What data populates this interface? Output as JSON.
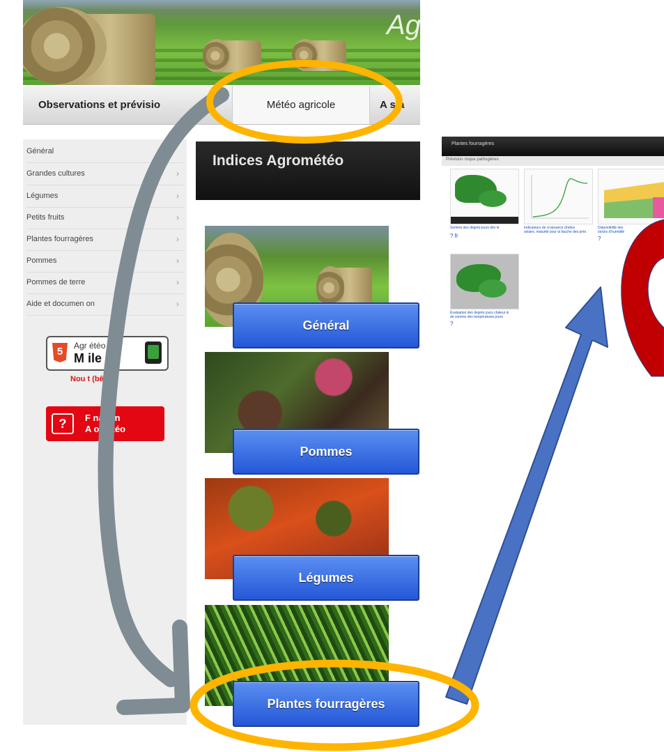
{
  "banner": {
    "title": "Ag"
  },
  "nav": {
    "tabs": [
      {
        "label": "Observations et prévisio"
      },
      {
        "label": "Météo agricole"
      },
      {
        "label": "A  s a"
      }
    ]
  },
  "sidebar": {
    "items": [
      {
        "label": "Général",
        "chevron": ""
      },
      {
        "label": "Grandes cultures",
        "chevron": "›"
      },
      {
        "label": "Légumes",
        "chevron": "›"
      },
      {
        "label": "Petits fruits",
        "chevron": "›"
      },
      {
        "label": "Plantes fourragères",
        "chevron": "›"
      },
      {
        "label": "Pommes",
        "chevron": "›"
      },
      {
        "label": "Pommes de terre",
        "chevron": "›"
      },
      {
        "label": "Aide et documen       on",
        "chevron": "›"
      }
    ],
    "mobile": {
      "badge": "5",
      "line1": "Agr   étéo",
      "line2": "M    ile",
      "note": "Nou    t (bêta)"
    },
    "formation": {
      "icon": "?",
      "line1": "F    nation",
      "line2": "A    oMétéo"
    }
  },
  "main": {
    "header": "Indices Agrométéo",
    "tiles": [
      {
        "label": "Général",
        "image": "hay-bales-field"
      },
      {
        "label": "Pommes",
        "image": "apple-blossom"
      },
      {
        "label": "Légumes",
        "image": "vegetable-leaves"
      },
      {
        "label": "Plantes fourragères",
        "image": "grass-closeup"
      }
    ]
  },
  "right_screenshot": {
    "header": "Plantes fourragères",
    "subheader": "Prévision risque pathogènes",
    "thumbs": [
      {
        "caption_line1": "Somme des degrés-jours dès le",
        "caption_line2": "",
        "q": "? fr"
      },
      {
        "caption_line1": "Indicateurs de croissance (Indice",
        "caption_line2": "solaire, maturité pour la fauche des prés",
        "q": ""
      },
      {
        "caption_line1": "Disponibilité des",
        "caption_line2": "stocks d'humidité",
        "q": "?"
      },
      {
        "caption_line1": "Évaluation des degrés jours chaleur &",
        "caption_line2": "de somme des températures jours",
        "q": "?"
      }
    ]
  },
  "annotations": {
    "highlight_color": "#ffb400",
    "arrow_gray": "#7f8c93",
    "arrow_blue": "#4a72c4",
    "red_arc": "#c00000"
  }
}
